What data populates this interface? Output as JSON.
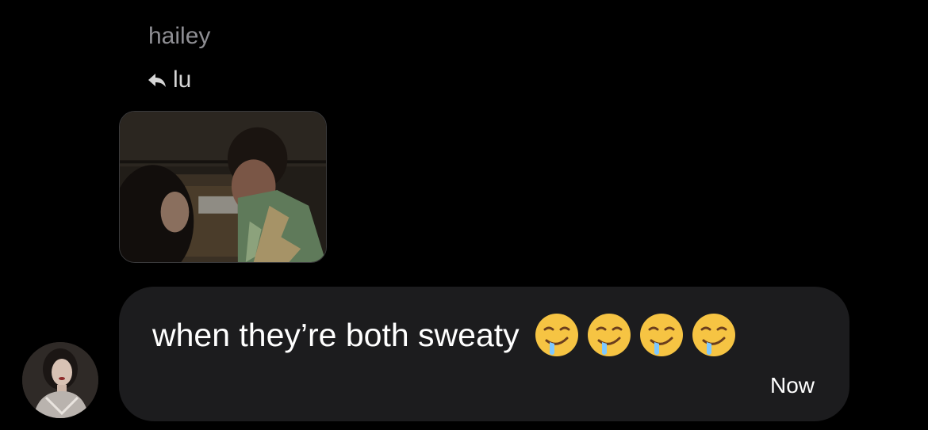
{
  "message": {
    "sender_name": "hailey",
    "reply_to": {
      "label": "lu",
      "icon": "reply-arrow-icon"
    },
    "quoted_media": {
      "icon": "movie-still-thumbnail"
    },
    "text": "when they’re both sweaty",
    "emojis": [
      "drooling-face-emoji",
      "drooling-face-emoji",
      "drooling-face-emoji",
      "drooling-face-emoji"
    ],
    "timestamp": "Now"
  },
  "colors": {
    "background": "#000000",
    "bubble": "#1c1c1e",
    "sender_name": "#8e8e93",
    "text": "#ffffff"
  }
}
